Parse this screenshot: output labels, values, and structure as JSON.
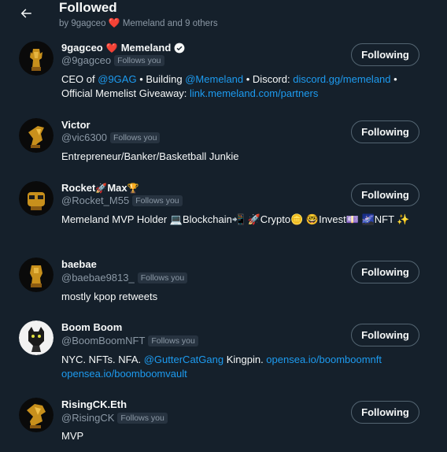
{
  "header": {
    "title": "Followed",
    "subtitle_prefix": "by 9gagceo",
    "subtitle_heart": "❤️",
    "subtitle_suffix": "Memeland and 9 others"
  },
  "follows_you_label": "Follows you",
  "following_label": "Following",
  "users": [
    {
      "name": "9gagceo",
      "name_heart": "❤️",
      "name_suffix": "Memeland",
      "verified": true,
      "handle": "@9gagceo",
      "bio": {
        "t1": "CEO of ",
        "l1": "@9GAG",
        "t2": " • Building ",
        "l2": "@Memeland",
        "t3": " • Discord: ",
        "l3": "discord.gg/memeland",
        "t4": " • Official Memelist Giveaway: ",
        "l4": "link.memeland.com/partners"
      }
    },
    {
      "name": "Victor",
      "handle": "@vic6300",
      "bio": "Entrepreneur/Banker/Basketball Junkie"
    },
    {
      "name": "Rocket",
      "name_emoji1": "🚀",
      "name_mid": "Max",
      "name_emoji2": "🏆",
      "handle": "@Rocket_M55",
      "bio": "Memeland MVP Holder 💻Blockchain📲 🚀Crypto🪙 🤓Invest💷 🌌NFT ✨"
    },
    {
      "name": "baebae",
      "handle": "@baebae9813_",
      "bio": "mostly kpop retweets"
    },
    {
      "name": "Boom Boom",
      "handle": "@BoomBoomNFT",
      "bio": {
        "t1": "NYC. NFTs. NFA. ",
        "l1": "@GutterCatGang",
        "t2": " Kingpin. ",
        "l2": "opensea.io/boomboomnft",
        "t3": " ",
        "l3": "opensea.io/boomboomvault"
      }
    },
    {
      "name": "RisingCK.Eth",
      "handle": "@RisingCK",
      "bio": "MVP"
    }
  ],
  "colors": {
    "background": "#15202b",
    "link": "#1d9bf0",
    "secondary_text": "#8b98a5",
    "heart": "#f91880"
  }
}
